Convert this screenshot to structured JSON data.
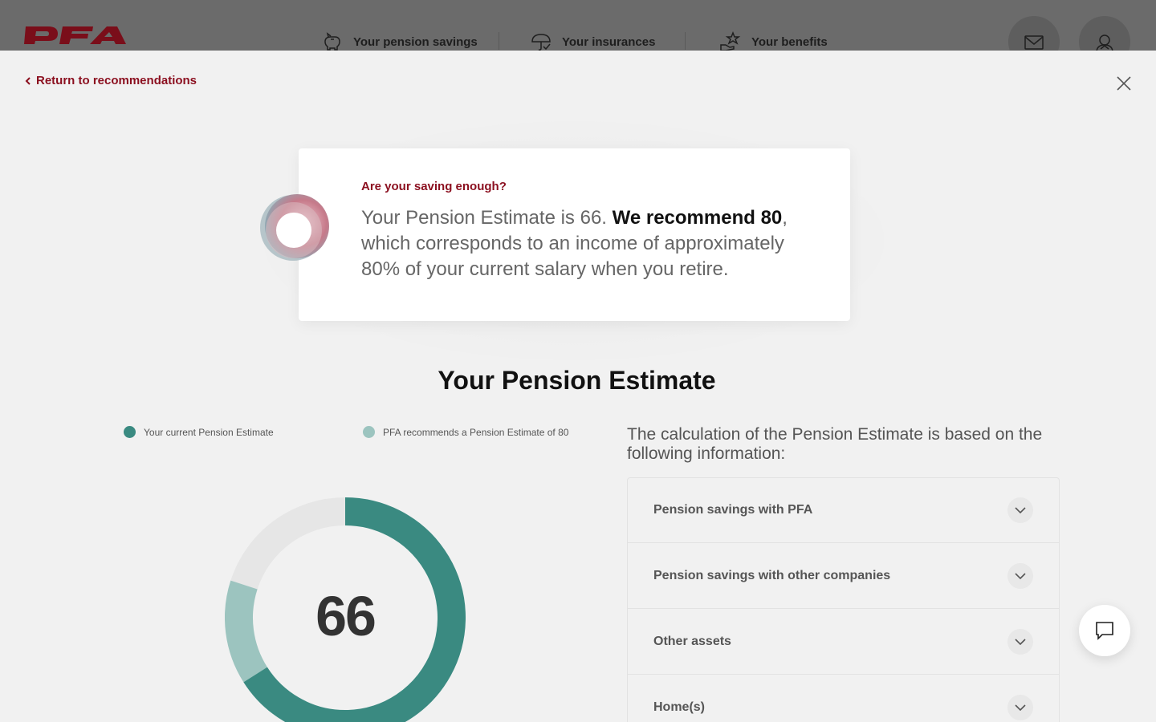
{
  "brand": {
    "logo_text": "PFA",
    "logo_color": "#8b0f1f"
  },
  "nav": {
    "items": [
      {
        "label": "Your pension savings",
        "icon": "piggy-bank-icon"
      },
      {
        "label": "Your insurances",
        "icon": "umbrella-icon"
      },
      {
        "label": "Your benefits",
        "icon": "benefits-hand-star-icon"
      }
    ],
    "actions": [
      {
        "icon": "mail-icon"
      },
      {
        "icon": "user-profile-icon"
      }
    ]
  },
  "modal": {
    "back_label": "Return to recommendations",
    "close_icon": "close-icon"
  },
  "recommendation": {
    "kicker": "Are your saving enough?",
    "text_before": "Your Pension Estimate is 66. ",
    "text_bold": "We recommend 80",
    "text_after": ", which corresponds to an income of approximately 80% of your current salary when you retire."
  },
  "estimate": {
    "title": "Your Pension Estimate",
    "legend": [
      {
        "label": "Your current Pension Estimate",
        "color": "#3a8a81"
      },
      {
        "label": "PFA recommends a Pension Estimate of 80",
        "color": "#9cc4bf"
      }
    ],
    "current_value": "66",
    "current": 66,
    "recommended": 80,
    "max": 100
  },
  "calculation": {
    "heading": "The calculation of the Pension Estimate is based on the following information:",
    "items": [
      {
        "label": "Pension savings with PFA"
      },
      {
        "label": "Pension savings with other companies"
      },
      {
        "label": "Other assets"
      },
      {
        "label": "Home(s)"
      }
    ]
  },
  "colors": {
    "accent": "#8b0f1f",
    "teal": "#3a8a81",
    "teal_light": "#9cc4bf",
    "track": "#e6e6e6"
  }
}
